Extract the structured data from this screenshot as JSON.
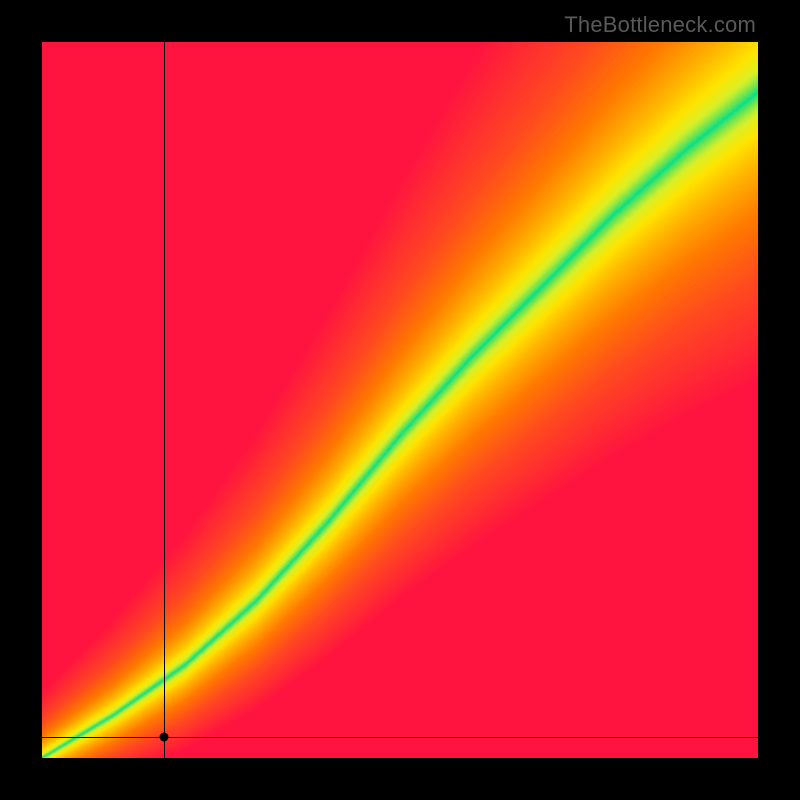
{
  "watermark": "TheBottleneck.com",
  "chart_data": {
    "type": "heatmap",
    "title": "",
    "xlabel": "",
    "ylabel": "",
    "xlim": [
      0,
      100
    ],
    "ylim": [
      0,
      100
    ],
    "curve_description": "Optimal-match ridge (green) running roughly along the diagonal with slight S-bend; surrounding field grades through yellow/orange to red with distance from the ridge.",
    "ridge_points": [
      {
        "x": 0,
        "y": 0
      },
      {
        "x": 10,
        "y": 6
      },
      {
        "x": 20,
        "y": 13
      },
      {
        "x": 30,
        "y": 22
      },
      {
        "x": 40,
        "y": 33
      },
      {
        "x": 50,
        "y": 45
      },
      {
        "x": 60,
        "y": 56
      },
      {
        "x": 70,
        "y": 66
      },
      {
        "x": 80,
        "y": 76
      },
      {
        "x": 90,
        "y": 85
      },
      {
        "x": 100,
        "y": 93
      }
    ],
    "ridge_half_width_frac": {
      "start": 0.012,
      "end": 0.085
    },
    "color_stops": [
      {
        "d": 0.0,
        "color": "#00e08c"
      },
      {
        "d": 0.06,
        "color": "#6fe552"
      },
      {
        "d": 0.12,
        "color": "#d8f02a"
      },
      {
        "d": 0.2,
        "color": "#ffe500"
      },
      {
        "d": 0.32,
        "color": "#ffb300"
      },
      {
        "d": 0.48,
        "color": "#ff7a00"
      },
      {
        "d": 0.68,
        "color": "#ff4a20"
      },
      {
        "d": 1.0,
        "color": "#ff1440"
      }
    ],
    "crosshair": {
      "x": 17,
      "y": 3
    },
    "grid": false,
    "legend": false
  }
}
